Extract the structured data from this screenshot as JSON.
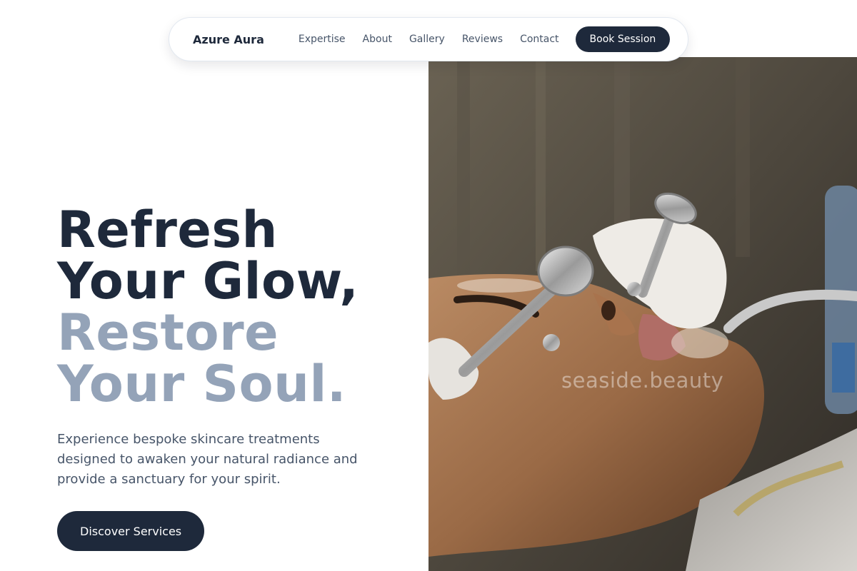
{
  "nav": {
    "brand": "Azure Aura",
    "links": [
      "Expertise",
      "About",
      "Gallery",
      "Reviews",
      "Contact"
    ],
    "cta": "Book Session"
  },
  "hero": {
    "headline_line1": "Refresh",
    "headline_line2": "Your Glow,",
    "headline_line3": "Restore",
    "headline_line4": "Your Soul.",
    "description": "Experience bespoke skincare treatments designed to awaken your natural radiance and provide a sanctuary for your spirit.",
    "cta": "Discover Services"
  },
  "image": {
    "watermark": "seaside.beauty"
  },
  "colors": {
    "primary": "#1e293b",
    "muted": "#94a3b8",
    "body_text": "#475569",
    "background": "#ffffff"
  }
}
